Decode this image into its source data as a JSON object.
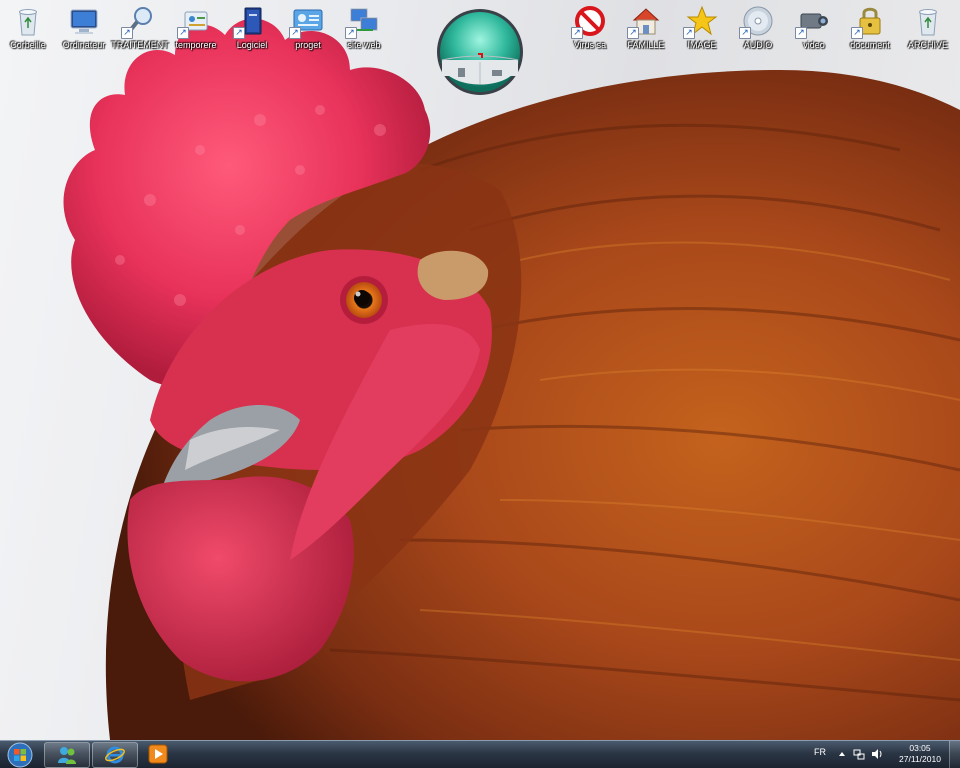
{
  "desktop": {
    "wallpaper": "rooster-closeup",
    "icons": [
      {
        "label": "Corbeille",
        "icon": "recycle-bin-icon",
        "shortcut": false
      },
      {
        "label": "Ordinateur",
        "icon": "computer-icon",
        "shortcut": false
      },
      {
        "label": "TRAITEMENT",
        "icon": "magnifier-icon",
        "shortcut": true
      },
      {
        "label": "temporere",
        "icon": "control-panel-icon",
        "shortcut": true
      },
      {
        "label": "Logiciel",
        "icon": "book-icon",
        "shortcut": true
      },
      {
        "label": "proget",
        "icon": "dashboard-icon",
        "shortcut": true
      },
      {
        "label": "site web",
        "icon": "network-icon",
        "shortcut": true
      },
      {
        "label": "Virus sa",
        "icon": "no-entry-icon",
        "shortcut": true
      },
      {
        "label": "FAMILLE",
        "icon": "house-icon",
        "shortcut": true
      },
      {
        "label": "IMAGE",
        "icon": "star-icon",
        "shortcut": true
      },
      {
        "label": "AUDIO",
        "icon": "disc-icon",
        "shortcut": true
      },
      {
        "label": "video",
        "icon": "camcorder-icon",
        "shortcut": true
      },
      {
        "label": "document",
        "icon": "padlock-icon",
        "shortcut": true
      },
      {
        "label": "ARCHIVE",
        "icon": "recycle-bin-icon",
        "shortcut": false
      }
    ]
  },
  "gadget": {
    "icon": "security-gadget-icon"
  },
  "taskbar": {
    "start_icon": "windows-logo-icon",
    "pinned": [
      {
        "icon": "messenger-icon"
      },
      {
        "icon": "internet-explorer-icon"
      },
      {
        "icon": "media-player-icon"
      }
    ],
    "language": "FR",
    "tray": [
      "chevron-up-icon",
      "network-tray-icon",
      "volume-icon"
    ],
    "clock": {
      "time": "03:05",
      "date": "27/11/2010"
    }
  }
}
